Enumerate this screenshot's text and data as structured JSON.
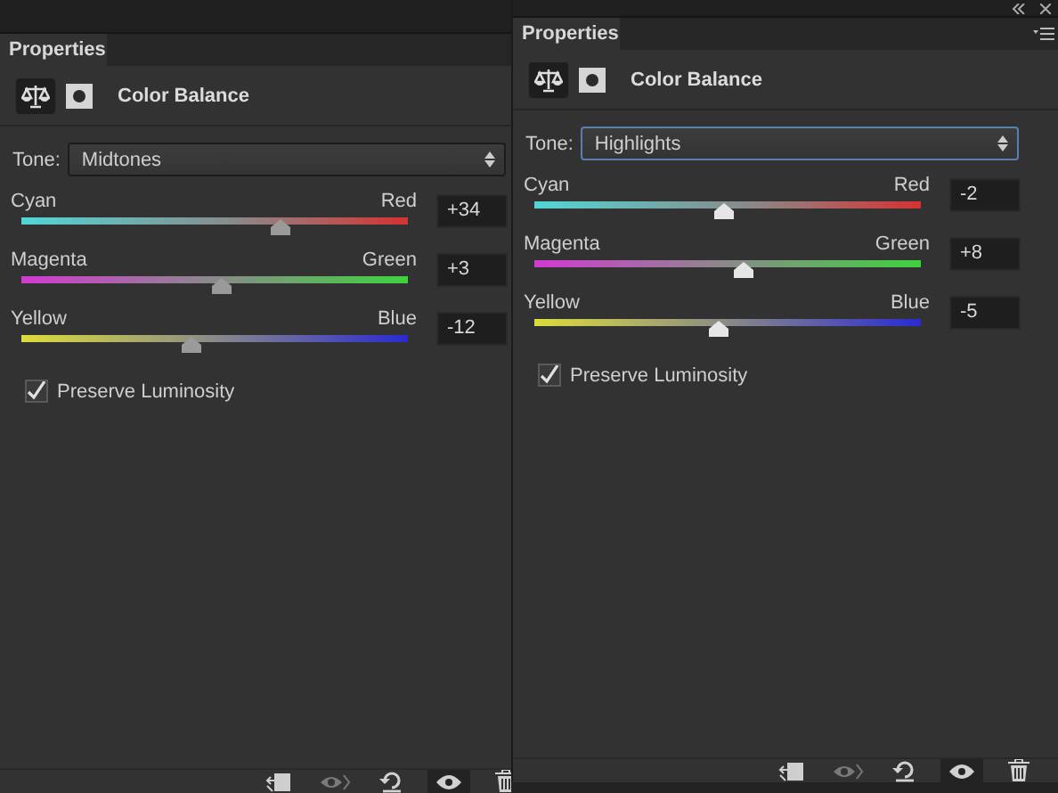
{
  "panels": [
    {
      "tab": "Properties",
      "title": "Color Balance",
      "tone_label": "Tone:",
      "tone": "Midtones",
      "window_controls": false,
      "tone_focused": false,
      "sliders": [
        {
          "left": "Cyan",
          "right": "Red",
          "level": 0.67,
          "value": "+34"
        },
        {
          "left": "Magenta",
          "right": "Green",
          "level": 0.515,
          "value": "+3"
        },
        {
          "left": "Yellow",
          "right": "Blue",
          "level": 0.44,
          "value": "-12"
        }
      ],
      "preserve": {
        "label": "Preserve Luminosity",
        "checked": true
      },
      "tools": [
        {
          "kind": "clip",
          "disabled": false,
          "selected": false
        },
        {
          "kind": "previous",
          "disabled": true,
          "selected": false
        },
        {
          "kind": "reset",
          "disabled": false,
          "selected": false
        },
        {
          "kind": "eye",
          "disabled": false,
          "selected": true
        },
        {
          "kind": "trash",
          "disabled": false,
          "selected": false
        }
      ]
    },
    {
      "tab": "Properties",
      "title": "Color Balance",
      "tone_label": "Tone:",
      "tone": "Highlights",
      "window_controls": true,
      "tone_focused": true,
      "sliders": [
        {
          "left": "Cyan",
          "right": "Red",
          "level": 0.49,
          "value": "-2"
        },
        {
          "left": "Magenta",
          "right": "Green",
          "level": 0.54,
          "value": "+8"
        },
        {
          "left": "Yellow",
          "right": "Blue",
          "level": 0.475,
          "value": "-5"
        }
      ],
      "preserve": {
        "label": "Preserve Luminosity",
        "checked": true
      },
      "tools": [
        {
          "kind": "clip",
          "disabled": false,
          "selected": false
        },
        {
          "kind": "previous",
          "disabled": true,
          "selected": false
        },
        {
          "kind": "reset",
          "disabled": false,
          "selected": false
        },
        {
          "kind": "eye",
          "disabled": false,
          "selected": true
        },
        {
          "kind": "trash",
          "disabled": false,
          "selected": false
        }
      ]
    }
  ]
}
